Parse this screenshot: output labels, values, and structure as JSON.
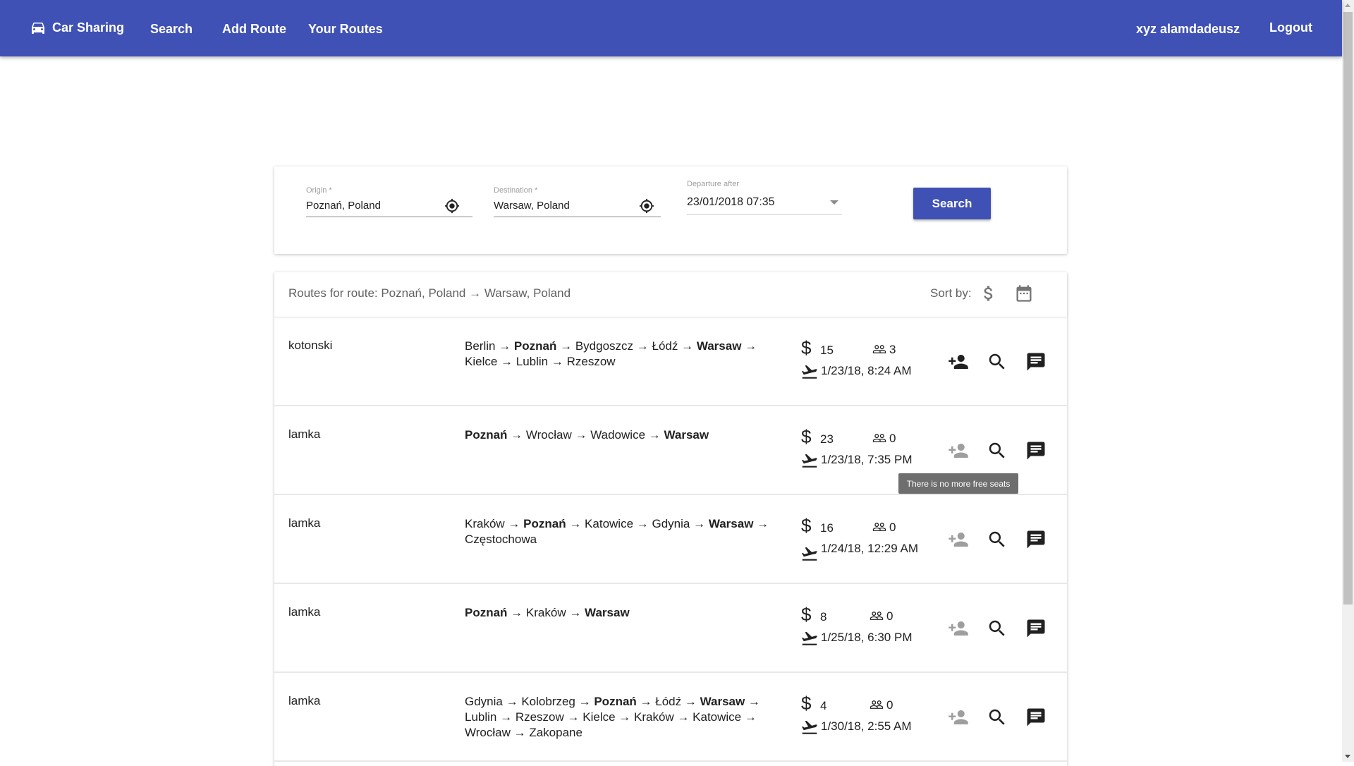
{
  "navbar": {
    "brand_label": "Car Sharing",
    "links": [
      "Search",
      "Add Route",
      "Your Routes"
    ],
    "username": "xyz alamdadeusz",
    "logout_label": "Logout",
    "color": "#3F51B5"
  },
  "search_form": {
    "origin": {
      "label": "Origin *",
      "value": "Poznań, Poland"
    },
    "destination": {
      "label": "Destination *",
      "value": "Warsaw, Poland"
    },
    "departure": {
      "label": "Departure after",
      "value": "23/01/2018 07:35"
    },
    "search_button": "Search"
  },
  "results": {
    "title": "Routes for route: Poznań, Poland → Warsaw, Poland",
    "sort_label": "Sort by:",
    "sort_options": [
      "price",
      "date"
    ],
    "tooltip": "There is no more free seats",
    "rows": [
      {
        "driver": "kotonski",
        "stops": [
          [
            "Berlin",
            false
          ],
          [
            "Poznań",
            true
          ],
          [
            "Bydgoszcz",
            false
          ],
          [
            "Łódź",
            false
          ],
          [
            "Warsaw",
            true
          ],
          [
            "Kielce",
            false
          ],
          [
            "Lublin",
            false
          ],
          [
            "Rzeszow",
            false
          ]
        ],
        "price": "15",
        "seats": "3",
        "date": "1/23/18, 8:24 AM",
        "join_enabled": true
      },
      {
        "driver": "lamka",
        "stops": [
          [
            "Poznań",
            true
          ],
          [
            "Wrocław",
            false
          ],
          [
            "Wadowice",
            false
          ],
          [
            "Warsaw",
            true
          ]
        ],
        "price": "23",
        "seats": "0",
        "date": "1/23/18, 7:35 PM",
        "join_enabled": false
      },
      {
        "driver": "lamka",
        "stops": [
          [
            "Kraków",
            false
          ],
          [
            "Poznań",
            true
          ],
          [
            "Katowice",
            false
          ],
          [
            "Gdynia",
            false
          ],
          [
            "Warsaw",
            true
          ],
          [
            "Częstochowa",
            false
          ]
        ],
        "price": "16",
        "seats": "0",
        "date": "1/24/18, 12:29 AM",
        "join_enabled": false
      },
      {
        "driver": "lamka",
        "stops": [
          [
            "Poznań",
            true
          ],
          [
            "Kraków",
            false
          ],
          [
            "Warsaw",
            true
          ]
        ],
        "price": "8",
        "seats": "0",
        "date": "1/25/18, 6:30 PM",
        "join_enabled": false
      },
      {
        "driver": "lamka",
        "stops": [
          [
            "Gdynia",
            false
          ],
          [
            "Kolobrzeg",
            false
          ],
          [
            "Poznań",
            true
          ],
          [
            "Łódź",
            false
          ],
          [
            "Warsaw",
            true
          ],
          [
            "Lublin",
            false
          ],
          [
            "Rzeszow",
            false
          ],
          [
            "Kielce",
            false
          ],
          [
            "Kraków",
            false
          ],
          [
            "Katowice",
            false
          ],
          [
            "Wrocław",
            false
          ],
          [
            "Zakopane",
            false
          ]
        ],
        "price": "4",
        "seats": "0",
        "date": "1/30/18, 2:55 AM",
        "join_enabled": false
      }
    ]
  },
  "icons": {
    "brand": "car-icon",
    "location": "gps-target-icon",
    "sort_price": "dollar-icon",
    "sort_date": "calendar-icon",
    "price": "dollar-icon",
    "seats": "people-outline-icon",
    "departure": "flight-takeoff-icon",
    "join": "person-add-icon",
    "details": "search-icon",
    "message": "chat-icon"
  }
}
